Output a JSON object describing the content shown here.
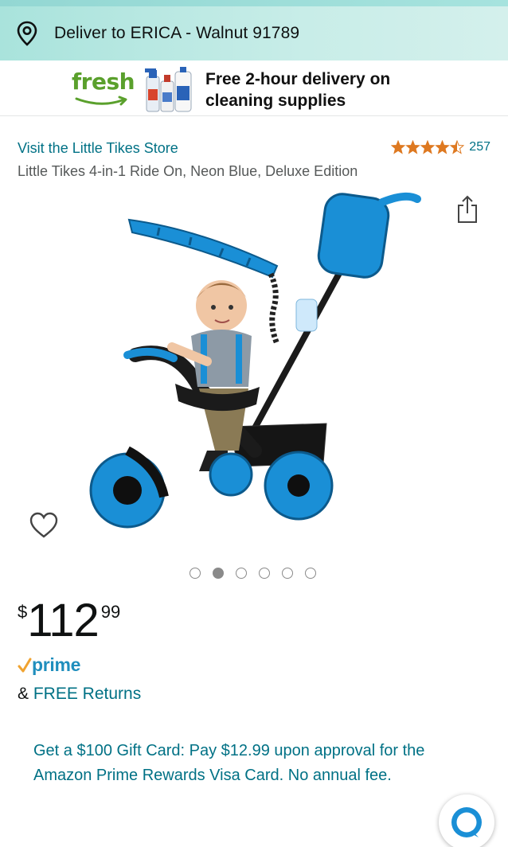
{
  "header": {
    "deliver_text": "Deliver to ERICA - Walnut 91789",
    "location_icon": "location-pin-icon"
  },
  "fresh_banner": {
    "logo_text": "fresh",
    "promo_line1": "Free 2-hour delivery on",
    "promo_line2": "cleaning supplies",
    "image": "cleaning-bottles-image"
  },
  "product": {
    "store_link": "Visit the Little Tikes Store",
    "rating_stars": 4.5,
    "rating_count": "257",
    "title": "Little Tikes 4-in-1 Ride On, Neon Blue, Deluxe Edition",
    "image": "tricycle-with-child-image",
    "image_count": 6,
    "active_image_index": 1
  },
  "price": {
    "symbol": "$",
    "whole": "112",
    "fraction": "99"
  },
  "prime": {
    "label": "prime"
  },
  "returns": {
    "prefix": "& ",
    "link": "FREE Returns"
  },
  "offer": {
    "text": "Get a $100 Gift Card: Pay $12.99 upon approval for the Amazon Prime Rewards Visa Card. No annual fee."
  },
  "colors": {
    "link": "#007185",
    "star": "#de7921",
    "prime": "#1f8ebd",
    "fresh_green": "#5aa02c",
    "product_blue": "#1a8fd6"
  }
}
